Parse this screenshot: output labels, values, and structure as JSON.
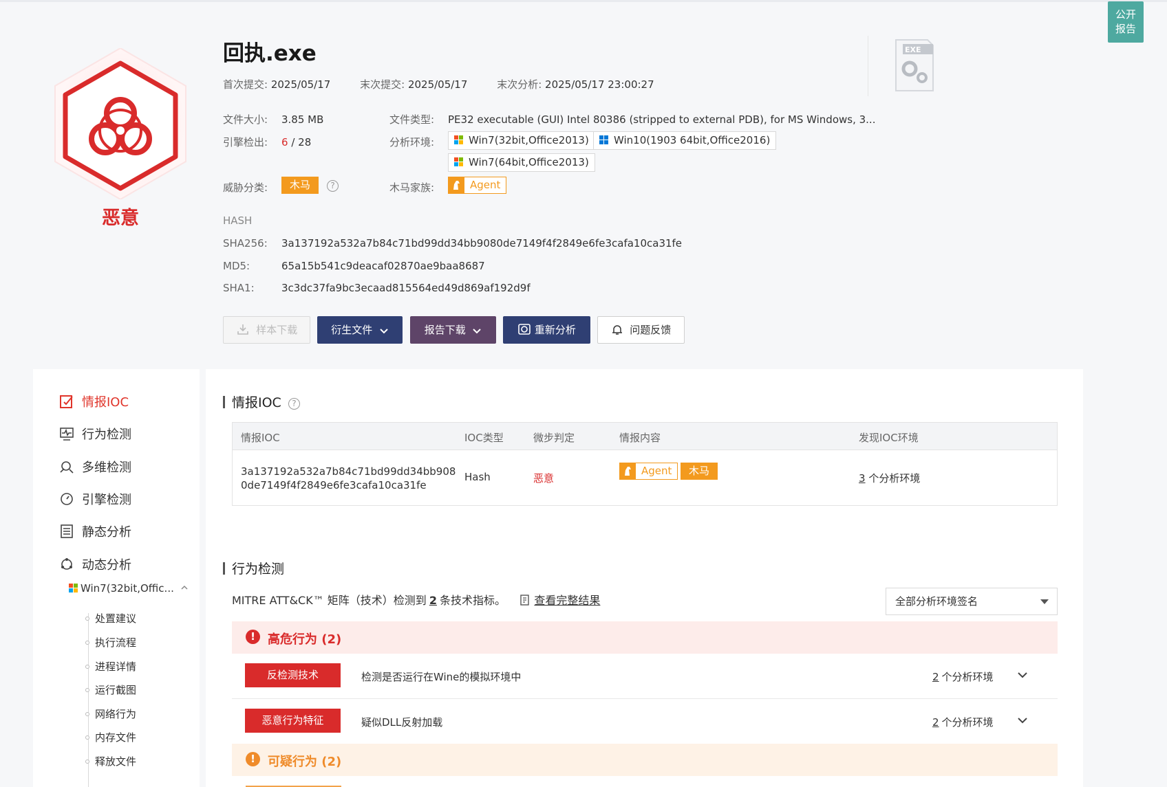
{
  "public_report": {
    "line1": "公开",
    "line2": "报告"
  },
  "verdict": "恶意",
  "file_title": "回执.exe",
  "submissions": {
    "first_label": "首次提交:",
    "first_value": "2025/05/17",
    "last_label": "末次提交:",
    "last_value": "2025/05/17",
    "analysis_label": "末次分析:",
    "analysis_value": "2025/05/17 23:00:27"
  },
  "file_info": {
    "size_label": "文件大小:",
    "size_value": "3.85 MB",
    "type_label": "文件类型:",
    "type_value": "PE32 executable (GUI) Intel 80386 (stripped to external PDB), for MS Windows, 3...",
    "engine_label": "引擎检出:",
    "engine_detected": "6",
    "engine_total": "/ 28",
    "env_label": "分析环境:",
    "envs": [
      "Win7(32bit,Office2013)",
      "Win10(1903 64bit,Office2016)",
      "Win7(64bit,Office2013)"
    ],
    "threat_label": "威胁分类:",
    "threat_value": "木马",
    "family_label": "木马家族:",
    "family_value": "Agent"
  },
  "exe_icon_text": "EXE",
  "hash": {
    "section_label": "HASH",
    "sha256_label": "SHA256:",
    "sha256": "3a137192a532a7b84c71bd99dd34bb9080de7149f4f2849e6fe3cafa10ca31fe",
    "md5_label": "MD5:",
    "md5": "65a15b541c9deacaf02870ae9baa8687",
    "sha1_label": "SHA1:",
    "sha1": "3c3dc37fa9bc3ecaad815564ed49d869af192d9f"
  },
  "actions": {
    "download": "样本下载",
    "derived": "衍生文件",
    "report": "报告下载",
    "reanalyze": "重新分析",
    "feedback": "问题反馈"
  },
  "sidebar": {
    "items": [
      "情报IOC",
      "行为检测",
      "多维检测",
      "引擎检测",
      "静态分析",
      "动态分析"
    ],
    "env": "Win7(32bit,Offic...",
    "sub_items": [
      "处置建议",
      "执行流程",
      "进程详情",
      "运行截图",
      "网络行为",
      "内存文件",
      "释放文件"
    ]
  },
  "ioc": {
    "title": "情报IOC",
    "headers": [
      "情报IOC",
      "IOC类型",
      "微步判定",
      "情报内容",
      "发现IOC环境"
    ],
    "row": {
      "ioc_line1": "3a137192a532a7b84c71bd99dd34bb908",
      "ioc_line2": "0de7149f4f2849e6fe3cafa10ca31fe",
      "type": "Hash",
      "verdict": "恶意",
      "family": "Agent",
      "category": "木马",
      "env_count": "3",
      "env_suffix": "个分析环境"
    }
  },
  "behavior": {
    "title": "行为检测",
    "mitre_prefix": "MITRE ATT&CK™ 矩阵（技术）检测到",
    "mitre_count": "2",
    "mitre_suffix": "条技术指标。",
    "full_link": "查看完整结果",
    "env_select": "全部分析环境签名",
    "high_label": "高危行为 (2)",
    "rows": [
      {
        "tag": "反检测技术",
        "desc": "检测是否运行在Wine的模拟环境中",
        "count": "2",
        "suffix": "个分析环境"
      },
      {
        "tag": "恶意行为特征",
        "desc": "疑似DLL反射加载",
        "count": "2",
        "suffix": "个分析环境"
      }
    ],
    "suspicious_label": "可疑行为 (2)"
  },
  "colors": {
    "accent_red": "#d92b2b",
    "orange": "#f39a1e",
    "navy": "#2f3f73",
    "plum": "#5e4468",
    "teal": "#4ea9a0"
  }
}
